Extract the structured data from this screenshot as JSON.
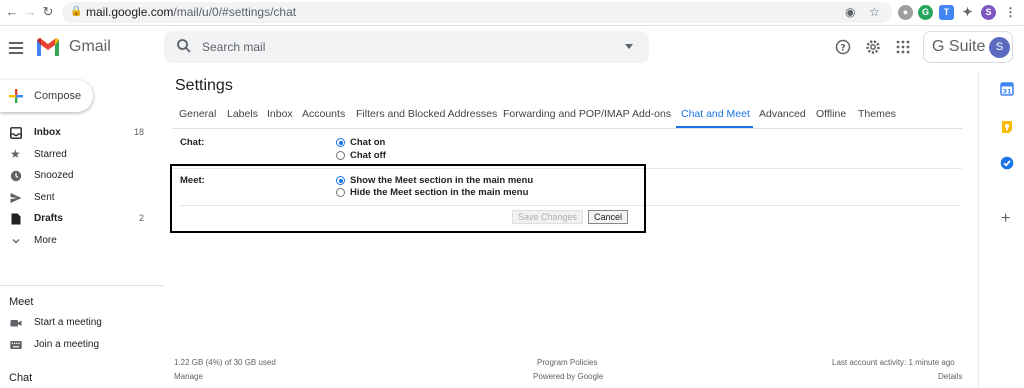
{
  "browser": {
    "url_host": "mail.google.com",
    "url_path": "/mail/u/0/#settings/chat",
    "avatar_letter": "S"
  },
  "header": {
    "app_name": "Gmail",
    "search_placeholder": "Search mail",
    "gsuite_label": "G Suite",
    "avatar_letter": "S"
  },
  "sidebar": {
    "compose_label": "Compose",
    "items": [
      {
        "label": "Inbox",
        "count": "18",
        "icon": "inbox-icon"
      },
      {
        "label": "Starred",
        "count": "",
        "icon": "star-icon"
      },
      {
        "label": "Snoozed",
        "count": "",
        "icon": "clock-icon"
      },
      {
        "label": "Sent",
        "count": "",
        "icon": "send-icon"
      },
      {
        "label": "Drafts",
        "count": "2",
        "icon": "draft-icon"
      },
      {
        "label": "More",
        "count": "",
        "icon": "chevron-down-icon"
      }
    ],
    "meet_header": "Meet",
    "meet_items": [
      {
        "label": "Start a meeting",
        "icon": "video-icon"
      },
      {
        "label": "Join a meeting",
        "icon": "keyboard-icon"
      }
    ],
    "chat_header": "Chat"
  },
  "settings": {
    "title": "Settings",
    "tabs": [
      "General",
      "Labels",
      "Inbox",
      "Accounts",
      "Filters and Blocked Addresses",
      "Forwarding and POP/IMAP",
      "Add-ons",
      "Chat and Meet",
      "Advanced",
      "Offline",
      "Themes"
    ],
    "active_tab": "Chat and Meet",
    "chat": {
      "label": "Chat:",
      "options": [
        "Chat on",
        "Chat off"
      ],
      "selected": "Chat on"
    },
    "meet": {
      "label": "Meet:",
      "options": [
        "Show the Meet section in the main menu",
        "Hide the Meet section in the main menu"
      ],
      "selected": "Show the Meet section in the main menu"
    },
    "save_label": "Save Changes",
    "cancel_label": "Cancel"
  },
  "footer": {
    "storage": "1.22 GB (4%) of 30 GB used",
    "manage": "Manage",
    "policies": "Program Policies",
    "powered": "Powered by Google",
    "activity": "Last account activity: 1 minute ago",
    "details": "Details"
  },
  "colors": {
    "accent": "#1a73e8",
    "highlight_border": "#000000"
  }
}
